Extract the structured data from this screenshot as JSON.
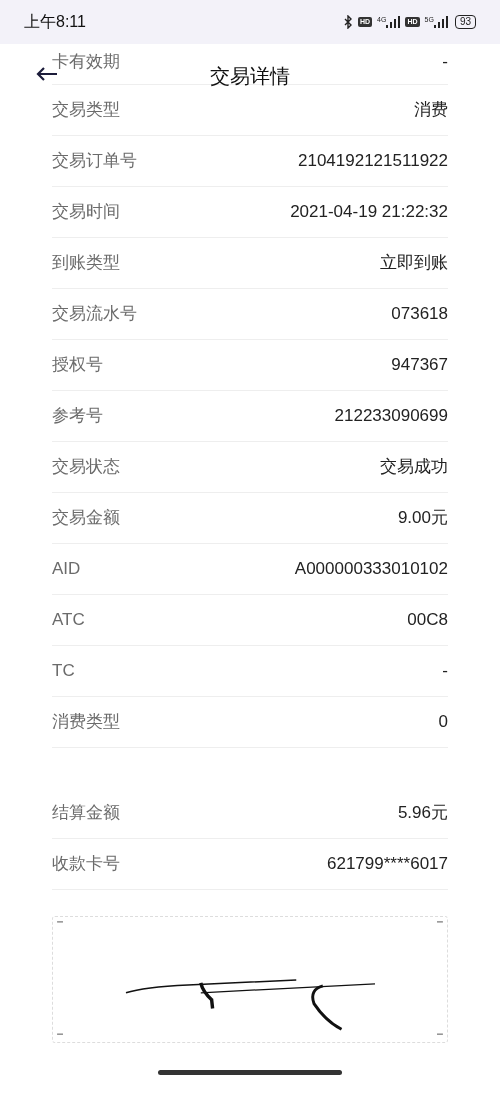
{
  "status_bar": {
    "time": "上午8:11",
    "hd_1": "HD",
    "network_1": "4G",
    "hd_2": "HD",
    "network_2": "5G",
    "battery": "93"
  },
  "header": {
    "title": "交易详情"
  },
  "details": [
    {
      "label": "卡有效期",
      "value": "-"
    },
    {
      "label": "交易类型",
      "value": "消费"
    },
    {
      "label": "交易订单号",
      "value": "2104192121511922"
    },
    {
      "label": "交易时间",
      "value": "2021-04-19 21:22:32"
    },
    {
      "label": "到账类型",
      "value": "立即到账"
    },
    {
      "label": "交易流水号",
      "value": "073618"
    },
    {
      "label": "授权号",
      "value": "947367"
    },
    {
      "label": "参考号",
      "value": "212233090699"
    },
    {
      "label": "交易状态",
      "value": "交易成功"
    },
    {
      "label": "交易金额",
      "value": "9.00元"
    },
    {
      "label": "AID",
      "value": "A000000333010102"
    },
    {
      "label": "ATC",
      "value": "00C8"
    },
    {
      "label": "TC",
      "value": "-"
    },
    {
      "label": "消费类型",
      "value": "0"
    }
  ],
  "settlement": [
    {
      "label": "结算金额",
      "value": "5.96元"
    },
    {
      "label": "收款卡号",
      "value": "621799****6017"
    }
  ]
}
